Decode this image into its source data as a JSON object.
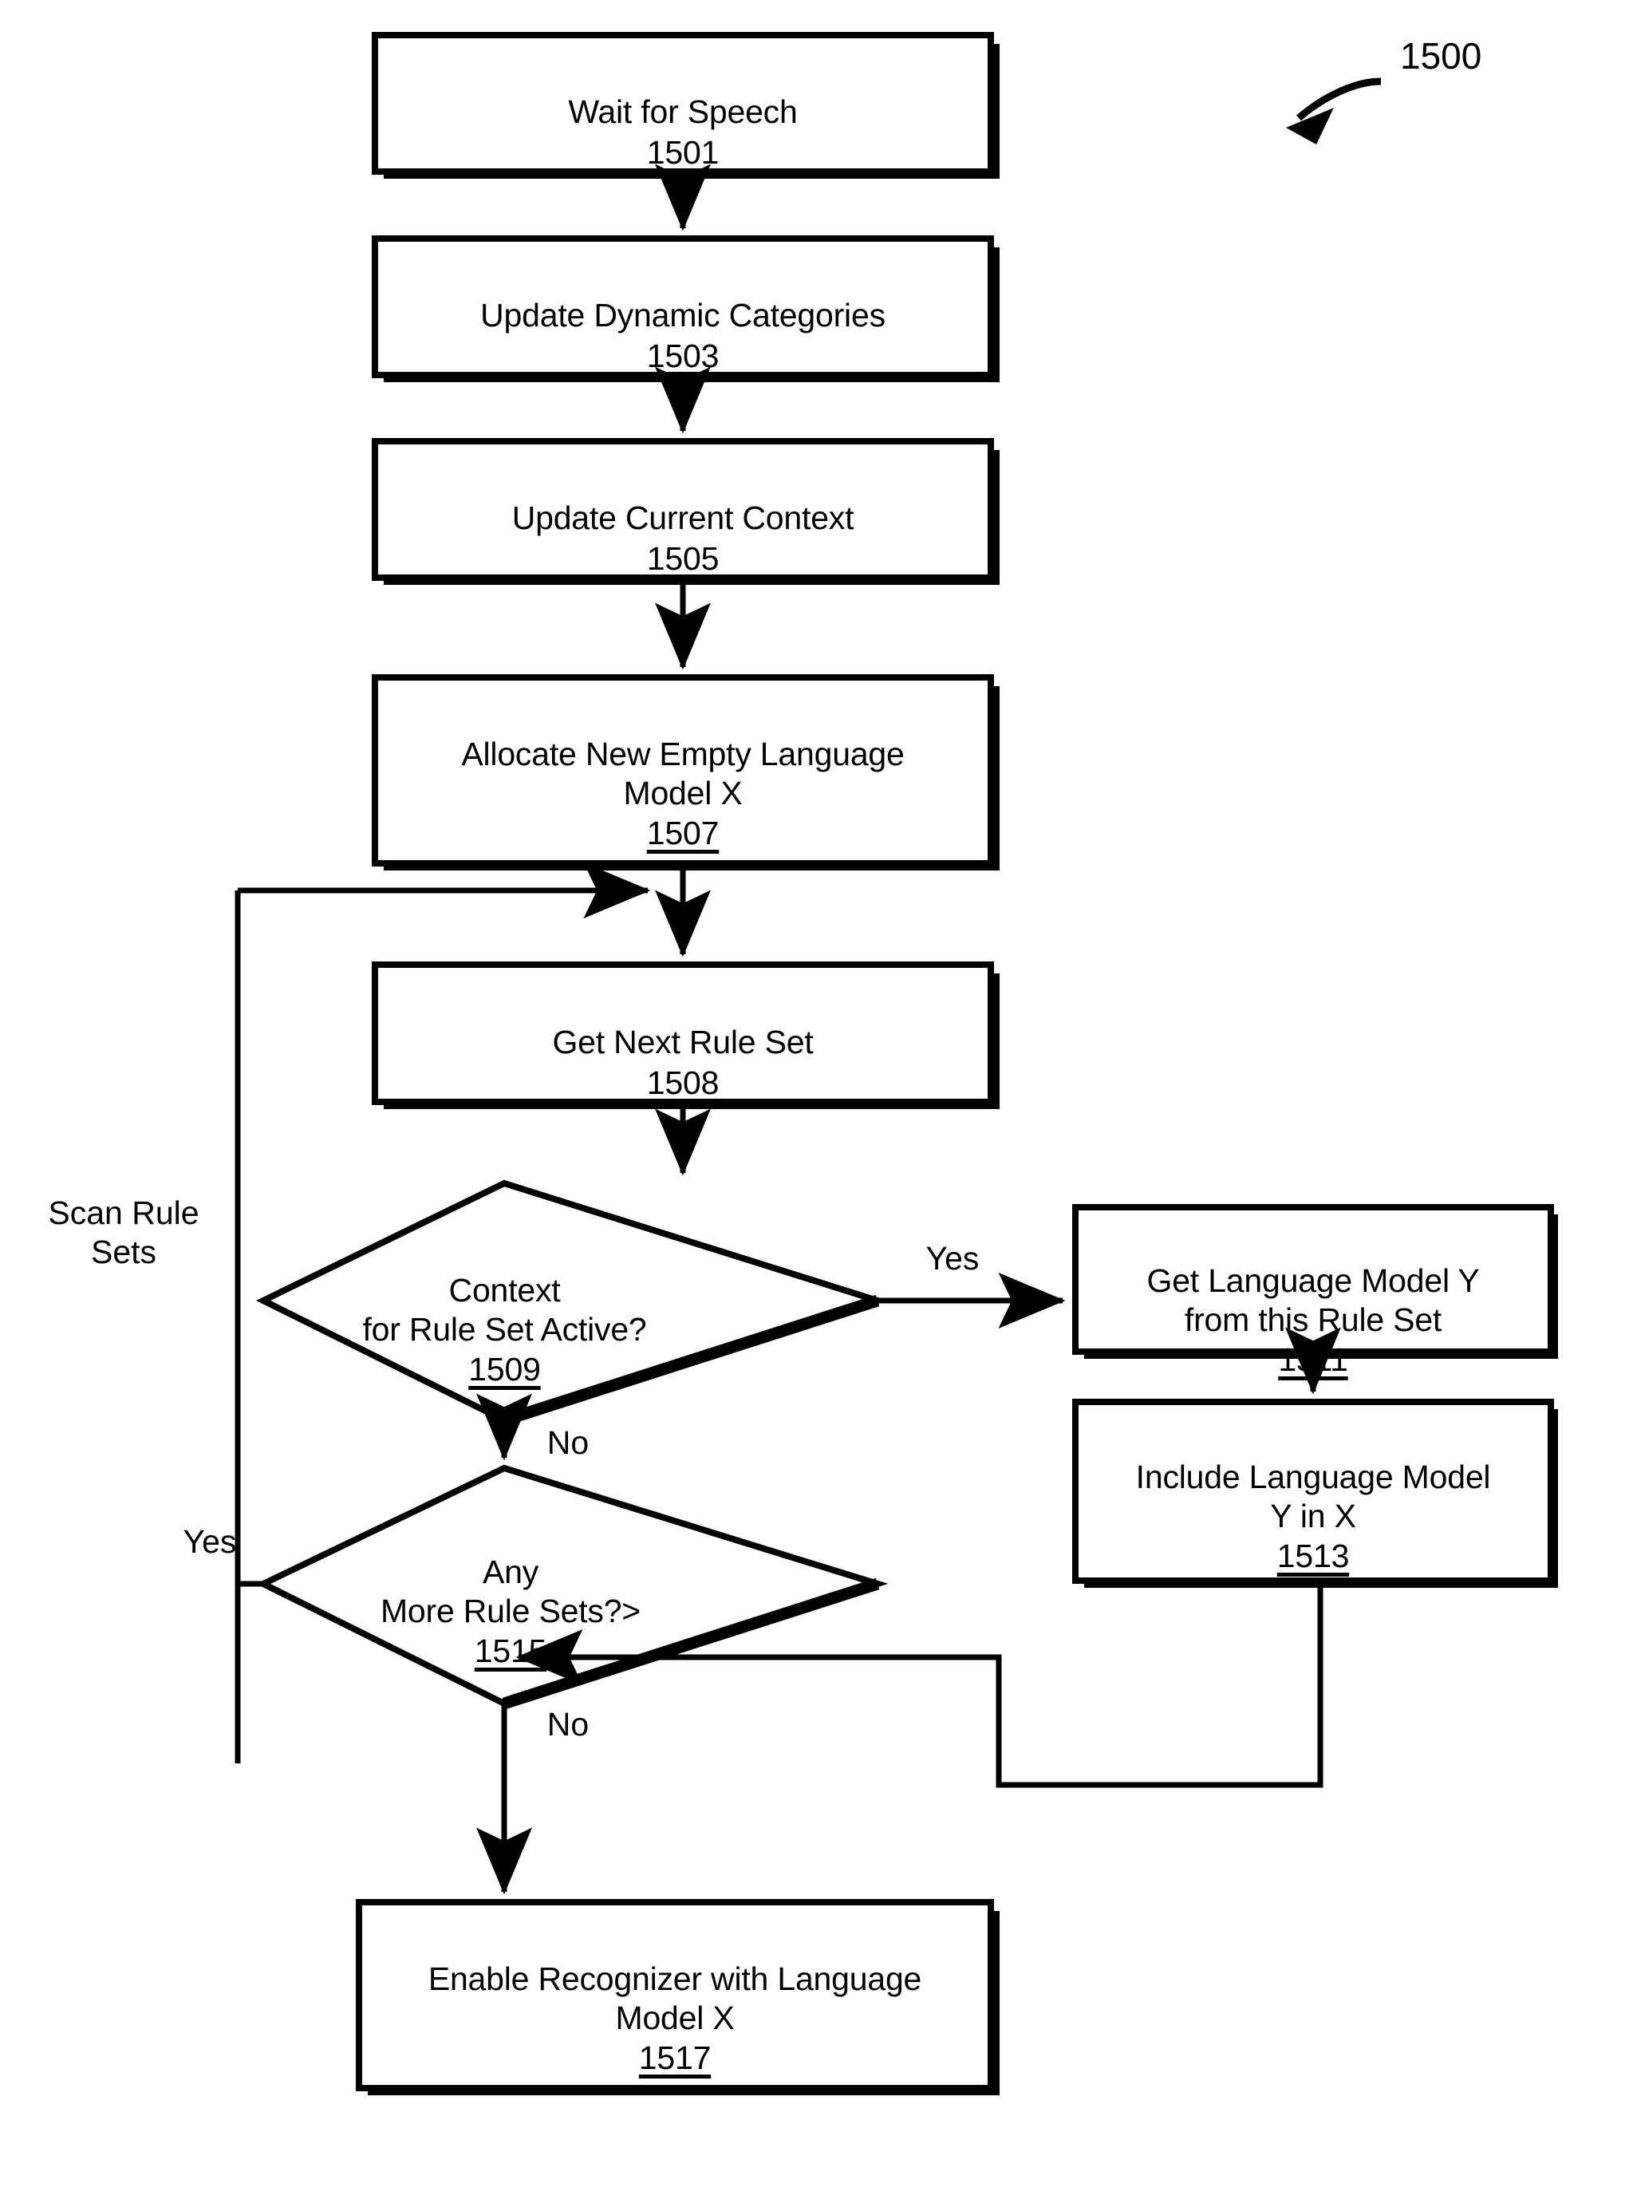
{
  "figure": {
    "number": "1500",
    "pointer_icon": "curved-arrow-icon"
  },
  "nodes": [
    {
      "id": "n1501",
      "shape": "process",
      "label": "Wait for Speech",
      "ref": "1501"
    },
    {
      "id": "n1503",
      "shape": "process",
      "label": "Update Dynamic Categories",
      "ref": "1503"
    },
    {
      "id": "n1505",
      "shape": "process",
      "label": "Update Current Context",
      "ref": "1505"
    },
    {
      "id": "n1507",
      "shape": "process",
      "label": "Allocate New Empty Language\nModel X",
      "ref": "1507"
    },
    {
      "id": "n1508",
      "shape": "process",
      "label": "Get Next Rule Set",
      "ref": "1508"
    },
    {
      "id": "n1509",
      "shape": "decision",
      "label": "Context\nfor Rule Set Active?",
      "ref": "1509"
    },
    {
      "id": "n1511",
      "shape": "process",
      "label": "Get Language Model Y\nfrom this Rule Set",
      "ref": "1511"
    },
    {
      "id": "n1513",
      "shape": "process",
      "label": "Include Language Model\nY in X",
      "ref": "1513"
    },
    {
      "id": "n1515",
      "shape": "decision",
      "label": "Any\nMore Rule Sets?>",
      "ref": "1515"
    },
    {
      "id": "n1517",
      "shape": "process",
      "label": "Enable Recognizer with Language\nModel X",
      "ref": "1517"
    }
  ],
  "edge_labels": {
    "scan_rule_sets": "Scan Rule\nSets",
    "yes_1509": "Yes",
    "no_1509": "No",
    "yes_1515": "Yes",
    "no_1515": "No"
  },
  "colors": {
    "stroke": "#000000",
    "fill": "#ffffff",
    "text": "#000000"
  }
}
